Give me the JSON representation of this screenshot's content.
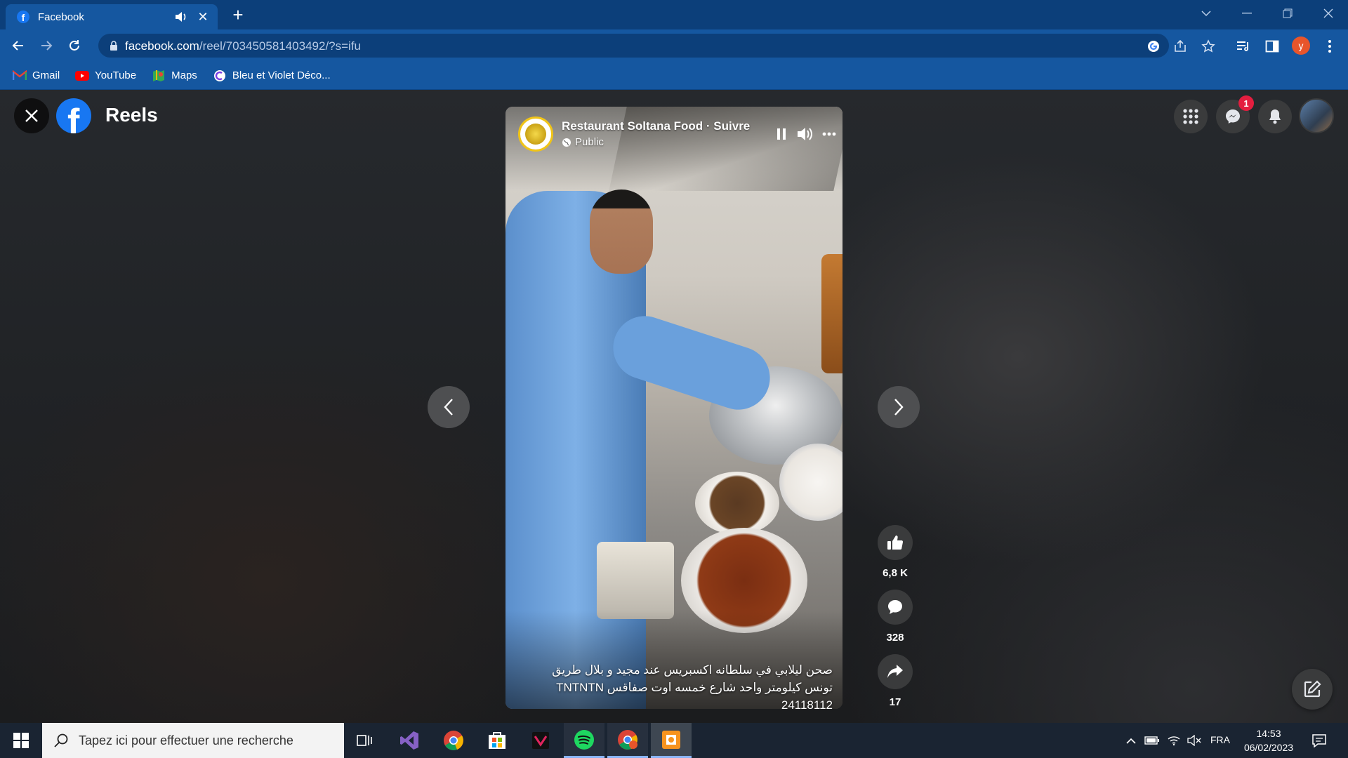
{
  "browser": {
    "tab_title": "Facebook",
    "new_tab_symbol": "+",
    "url_host": "facebook.com",
    "url_path": "/reel/703450581403492/?s=ifu",
    "profile_initial": "y",
    "bookmarks": [
      {
        "label": "Gmail",
        "icon": "gmail-icon"
      },
      {
        "label": "YouTube",
        "icon": "youtube-icon"
      },
      {
        "label": "Maps",
        "icon": "maps-icon"
      },
      {
        "label": "Bleu et Violet Déco...",
        "icon": "site-icon"
      }
    ]
  },
  "facebook": {
    "section_title": "Reels",
    "notification_count": "1",
    "reel": {
      "page_name": "Restaurant Soltana Food · Suivre",
      "audience": "Public",
      "caption_lines": [
        "صحن ليلابي في سلطانه اكسبريس عند مجيد و بلال طريق",
        "تونس كيلومتر واحد شارع خمسه اوت صفاقس TNTNTN",
        "24118112"
      ],
      "likes": "6,8 K",
      "comments": "328",
      "shares": "17"
    }
  },
  "taskbar": {
    "search_placeholder": "Tapez ici pour effectuer une recherche",
    "language": "FRA",
    "time": "14:53",
    "date": "06/02/2023"
  },
  "colors": {
    "chrome_frame": "#0c3f7a",
    "chrome_toolbar": "#1557a0",
    "facebook_blue": "#1877f2",
    "badge_red": "#e41e3f"
  }
}
